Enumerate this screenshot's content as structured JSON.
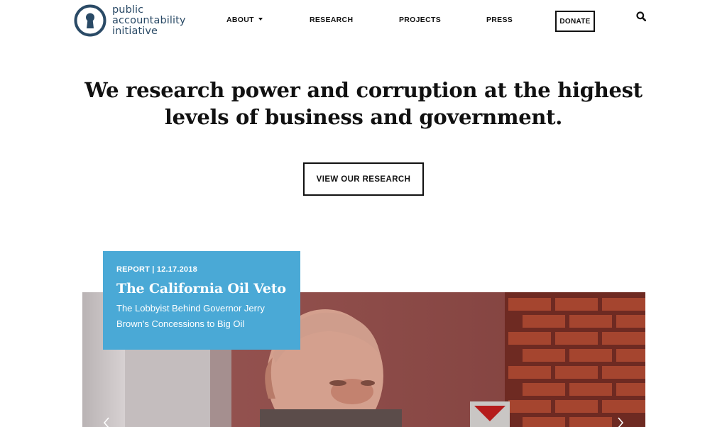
{
  "brand": {
    "line1": "public",
    "line2": "accountability",
    "line3": "initiative",
    "color": "#2a4a66"
  },
  "nav": {
    "about": "ABOUT",
    "research": "RESEARCH",
    "projects": "PROJECTS",
    "press": "PRESS",
    "donate": "DONATE"
  },
  "hero": {
    "heading": "We research power and corruption at the highest levels of business and government.",
    "button_label": "VIEW OUR RESEARCH"
  },
  "feature": {
    "meta": "REPORT | 12.17.2018",
    "title": "The California Oil Veto",
    "subtitle": "The Lobbyist Behind Governor Jerry Brown's Concessions to Big Oil",
    "card_color": "#4aa9d6"
  },
  "icons": {
    "search": "search-icon",
    "caret": "chevron-down-icon",
    "prev": "chevron-left-icon",
    "next": "chevron-right-icon",
    "logo": "keyhole-icon"
  }
}
